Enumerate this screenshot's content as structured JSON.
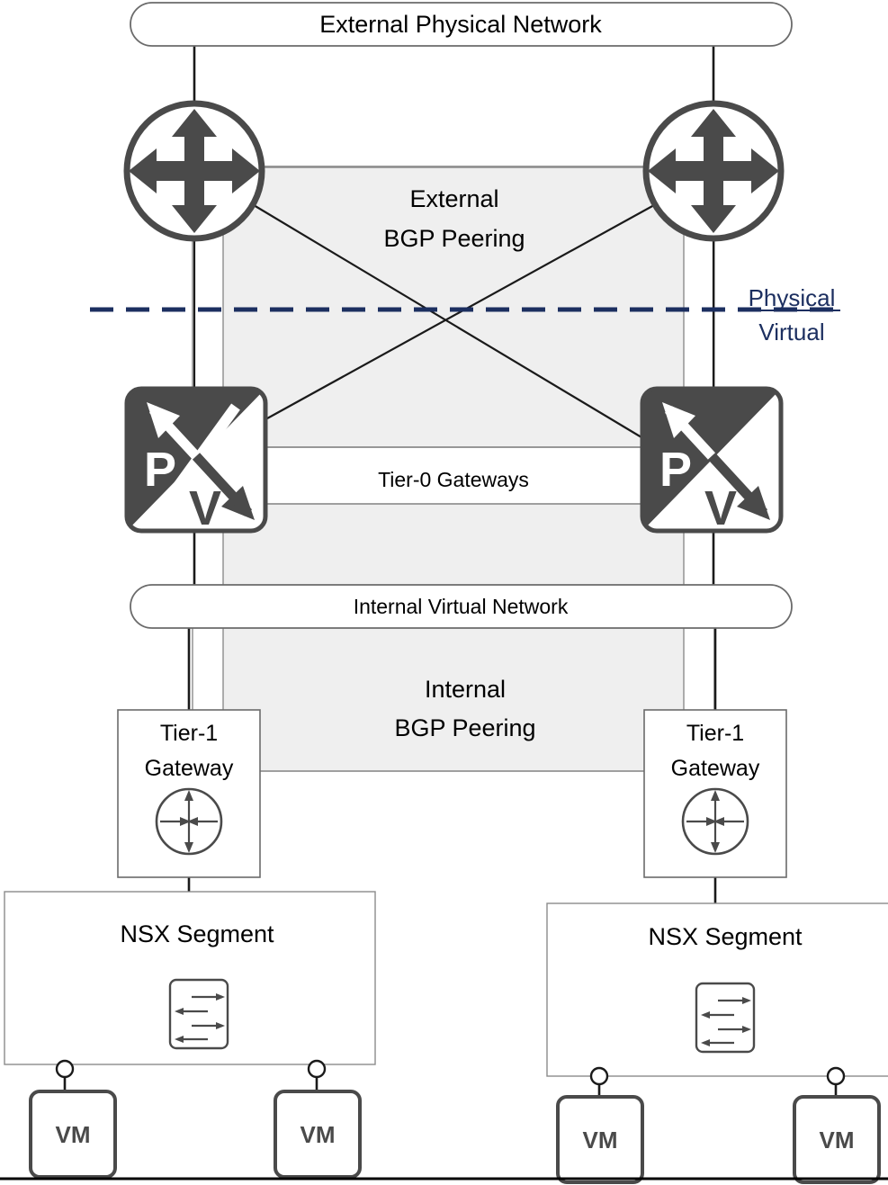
{
  "diagram": {
    "title_top": "External Physical Network",
    "title_internal": "Internal Virtual Network",
    "external_peering_line1": "External",
    "external_peering_line2": "BGP Peering",
    "internal_peering_line1": "Internal",
    "internal_peering_line2": "BGP Peering",
    "tier0_label": "Tier-0 Gateways",
    "boundary": {
      "above_label": "Physical",
      "below_label": "Virtual",
      "color": "#1c2f60"
    },
    "tier0_gateways": [
      {
        "glyph_physical": "P",
        "glyph_virtual": "V"
      },
      {
        "glyph_physical": "P",
        "glyph_virtual": "V"
      }
    ],
    "tier1_gateways": [
      {
        "line1": "Tier-1",
        "line2": "Gateway"
      },
      {
        "line1": "Tier-1",
        "line2": "Gateway"
      }
    ],
    "segments": [
      {
        "label": "NSX Segment",
        "vms": [
          {
            "label": "VM"
          },
          {
            "label": "VM"
          }
        ]
      },
      {
        "label": "NSX Segment",
        "vms": [
          {
            "label": "VM"
          },
          {
            "label": "VM"
          }
        ]
      }
    ],
    "colors": {
      "shade_fill": "#efefef",
      "icon_dark": "#4a4a4a",
      "outline": "#8c8c8c",
      "text": "#000000"
    }
  }
}
